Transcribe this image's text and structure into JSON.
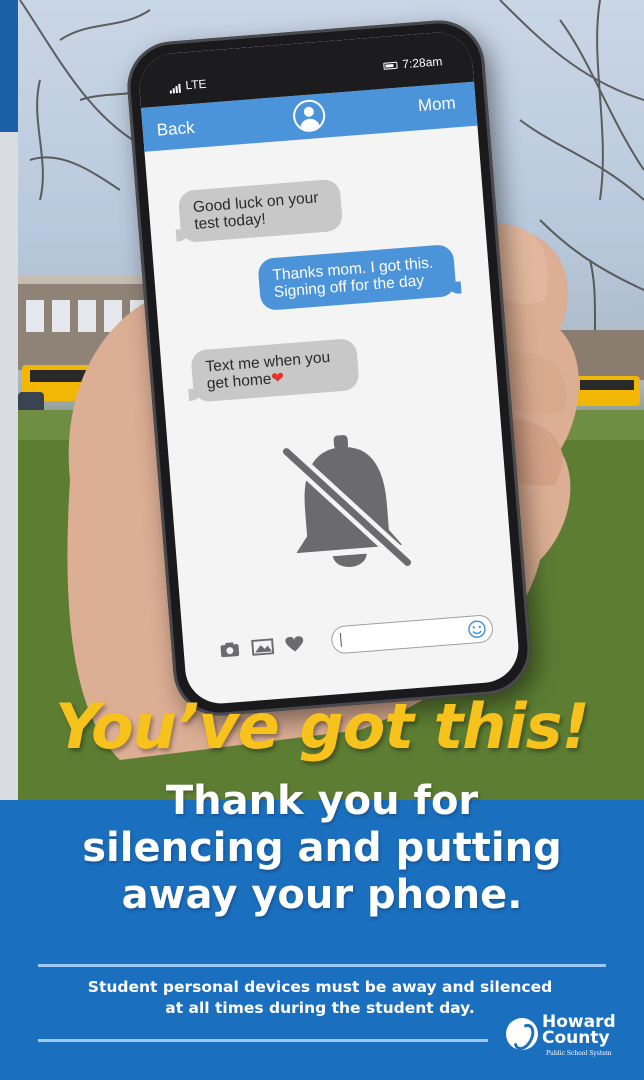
{
  "phone": {
    "status": {
      "carrier": "LTE",
      "time": "7:28am"
    },
    "nav": {
      "back_label": "Back",
      "contact_name": "Mom"
    },
    "messages": [
      {
        "direction": "incoming",
        "line1": "Good luck on your",
        "line2": "test today!"
      },
      {
        "direction": "outgoing",
        "line1": "Thanks mom. I got this.",
        "line2": "Signing off for the day"
      },
      {
        "direction": "incoming",
        "line1": "Text me when you",
        "line2": "get home"
      }
    ],
    "icons": {
      "muted": "bell-slash-icon",
      "compose": [
        "camera-icon",
        "image-icon",
        "heart-icon",
        "smiley-icon"
      ]
    }
  },
  "headline": "You’ve got this!",
  "sub_heading": {
    "line1": "Thank you for",
    "line2": "silencing and putting",
    "line3": "away your phone."
  },
  "policy": {
    "line1": "Student personal devices must be away and silenced",
    "line2": "at all times during the student day."
  },
  "logo": {
    "line1": "Howard",
    "line2": "County",
    "tagline": "Public School System"
  },
  "colors": {
    "panel_blue": "#1b6fbf",
    "message_blue": "#4b94d9",
    "headline_yellow": "#f8c21c",
    "incoming_gray": "#c8c8c8",
    "divider_blue": "#9ccaf2"
  }
}
